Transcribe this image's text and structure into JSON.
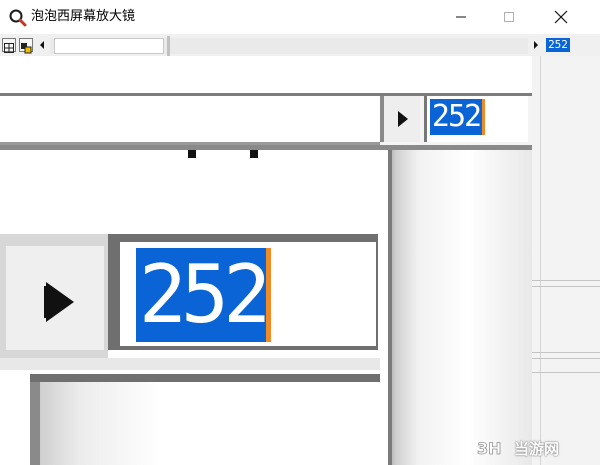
{
  "window": {
    "title": "泡泡西屏幕放大镜",
    "icon": "magnifier-icon",
    "controls": [
      "minimize-icon",
      "maximize-icon",
      "close-icon"
    ]
  },
  "toolbar": {
    "grid_icon": "grid-icon",
    "pointer_icon": "pointer-icon",
    "value": "252"
  },
  "magnified_view": {
    "upper_value": "252",
    "lower_value": "252"
  },
  "watermark": {
    "text": "当游网"
  },
  "colors": {
    "selection": "#0a64d6",
    "caret": "#f08a24",
    "frame": "#7a7a7a"
  }
}
